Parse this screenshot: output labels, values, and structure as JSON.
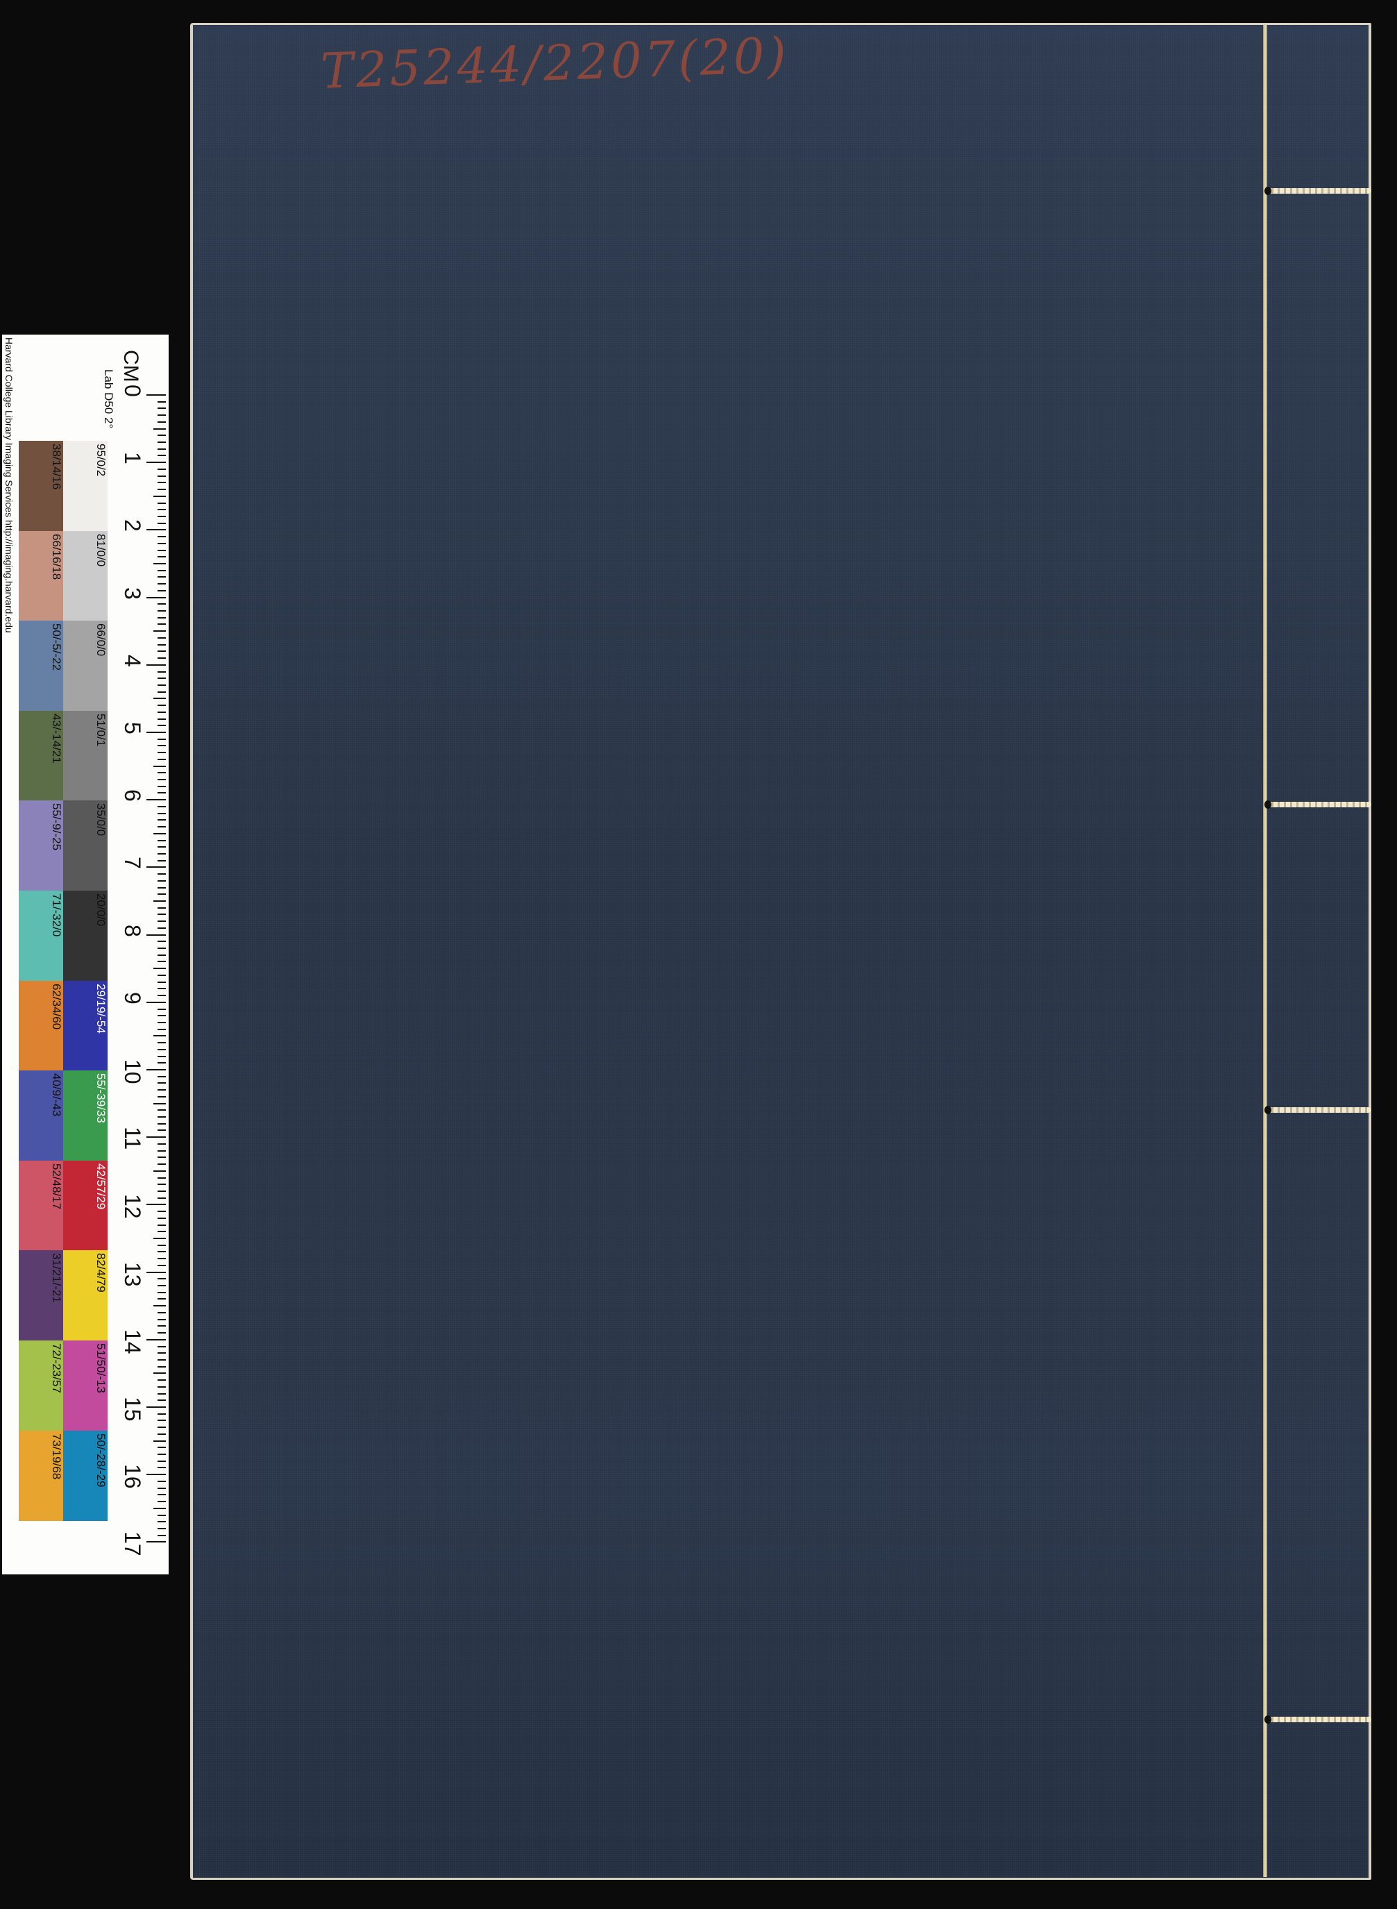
{
  "book": {
    "call_number": "T25244/2207(20)"
  },
  "color_chart": {
    "credit": "Harvard College Library Imaging Services http://imaging.harvard.edu",
    "lab_note": "Lab D50 2°",
    "unit": "CM",
    "ruler_labels": [
      "0",
      "1",
      "2",
      "3",
      "4",
      "5",
      "6",
      "7",
      "8",
      "9",
      "10",
      "11",
      "12",
      "13",
      "14",
      "15",
      "16",
      "17"
    ],
    "color_swatches": [
      {
        "label": "38/14/16",
        "color": "#72513f"
      },
      {
        "label": "66/16/18",
        "color": "#c5937f"
      },
      {
        "label": "50/-5/-22",
        "color": "#6580a4"
      },
      {
        "label": "43/-14/21",
        "color": "#5c6e47"
      },
      {
        "label": "55/-9/-25",
        "color": "#8a82b8"
      },
      {
        "label": "71/-32/0",
        "color": "#5dbdb0"
      },
      {
        "label": "62/34/60",
        "color": "#dc8230"
      },
      {
        "label": "40/9/-43",
        "color": "#4b55a8"
      },
      {
        "label": "52/48/17",
        "color": "#cd5565"
      },
      {
        "label": "31/21/-21",
        "color": "#5b3d70"
      },
      {
        "label": "72/-23/57",
        "color": "#a4c24b"
      },
      {
        "label": "73/19/68",
        "color": "#e7a42f"
      }
    ],
    "gray_swatches": [
      {
        "label": "95/0/2",
        "color": "#f0eeeb"
      },
      {
        "label": "81/0/0",
        "color": "#cbcbcb"
      },
      {
        "label": "66/0/0",
        "color": "#a4a4a4"
      },
      {
        "label": "51/0/1",
        "color": "#7f7f7f"
      },
      {
        "label": "35/0/0",
        "color": "#595959"
      },
      {
        "label": "20/0/0",
        "color": "#333333"
      },
      {
        "label": "29/19/-54",
        "color": "#2f35a4"
      },
      {
        "label": "55/-39/33",
        "color": "#3a9a4d"
      },
      {
        "label": "42/57/29",
        "color": "#c32635"
      },
      {
        "label": "82/4/79",
        "color": "#ecce28"
      },
      {
        "label": "51/50/-13",
        "color": "#c34b9d"
      },
      {
        "label": "50/-28/-29",
        "color": "#1786b9"
      }
    ]
  }
}
